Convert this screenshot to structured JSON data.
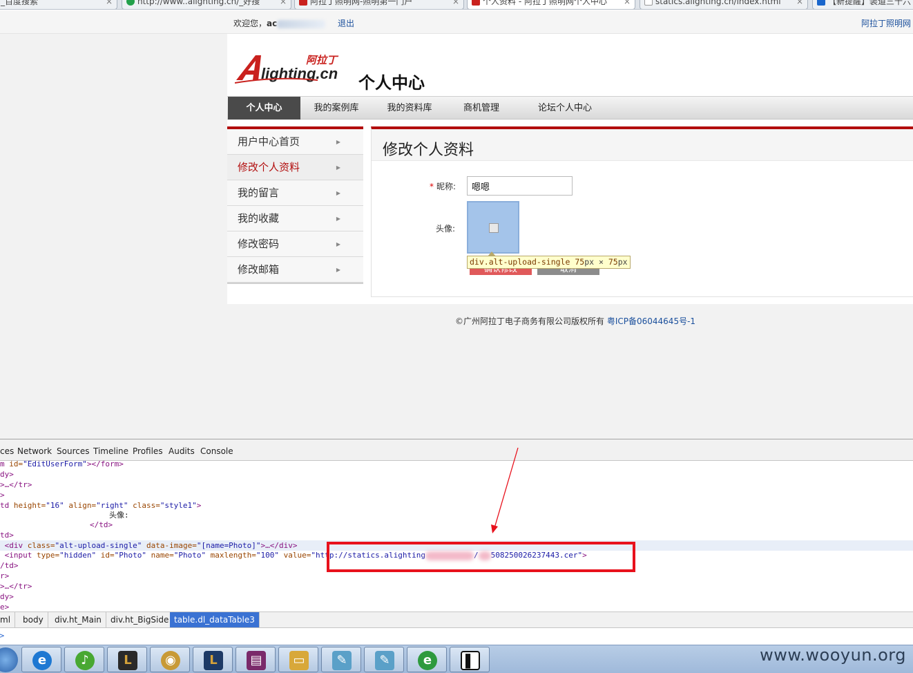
{
  "browser": {
    "tabs": [
      {
        "label": "_百度搜索",
        "favicon_color": "#3f7ee0",
        "active": false
      },
      {
        "label": "http://www..alighting.cn/_好搜",
        "favicon_color": "#23a04a",
        "active": false
      },
      {
        "label": "阿拉丁照明网-照明第一门户",
        "favicon_color": "#c9211e",
        "active": false
      },
      {
        "label": "个人资料 - 阿拉丁照明网个人中心",
        "favicon_color": "#c9211e",
        "active": true
      },
      {
        "label": "statics.alighting.cn/index.html",
        "favicon_color": "#ffffff",
        "active": false
      },
      {
        "label": "【新提醒】装道三十六",
        "favicon_color": "#1a66cc",
        "active": false
      }
    ],
    "close_glyph": "×"
  },
  "topbar": {
    "welcome_label": "欢迎您，",
    "username_visible": "ac",
    "logout": "退出",
    "site_link": "阿拉丁照明网"
  },
  "header": {
    "logo_text": "Alighting.cn",
    "logo_cn": "阿拉丁",
    "page_title": "个人中心"
  },
  "mainnav": {
    "items": [
      "个人中心",
      "我的案例库",
      "我的资料库",
      "商机管理",
      "论坛个人中心"
    ]
  },
  "sidemenu": {
    "items": [
      "用户中心首页",
      "修改个人资料",
      "我的留言",
      "我的收藏",
      "修改密码",
      "修改邮箱"
    ],
    "arrow": "▶"
  },
  "form": {
    "title": "修改个人资料",
    "required_mark": "*",
    "nickname_label": "昵称:",
    "nickname_value": "嗯嗯",
    "avatar_label": "头像:",
    "save_button": "确认修改",
    "cancel_button": "取消",
    "tooltip_selector": "div.alt-upload-single",
    "tooltip_w": "75",
    "tooltip_h": "75",
    "tooltip_unit": "px",
    "tooltip_times": "×"
  },
  "footer": {
    "copyright": "©广州阿拉丁电子商务有限公司版权所有",
    "icp": "粤ICP备06044645号-1"
  },
  "devtools": {
    "tabs": [
      "ces",
      "Network",
      "Sources",
      "Timeline",
      "Profiles",
      "Audits",
      "Console"
    ],
    "lines": [
      {
        "pre": "m ",
        "attr": "id=",
        "val": "\"EditUserForm\"",
        "post": "></form>"
      },
      {
        "pre": "dy>",
        "attr": "",
        "val": "",
        "post": ""
      },
      {
        "pre": ">…</tr>",
        "attr": "",
        "val": "",
        "post": ""
      },
      {
        "pre": ">",
        "attr": "",
        "val": "",
        "post": ""
      },
      {
        "pre": "td ",
        "attr": "height=",
        "val": "\"16\"",
        "post": ""
      },
      {
        "pre": "",
        "attr": "",
        "val": "",
        "post": ""
      },
      {
        "pre": "",
        "attr": "",
        "val": "",
        "post": ""
      },
      {
        "pre": "td>",
        "attr": "",
        "val": "",
        "post": ""
      }
    ],
    "td_line_rest": " align=\"right\" class=\"style1\">",
    "avatar_text": "头像:",
    "close_td": "</td>",
    "div_line": {
      "tag": "<div ",
      "attr1": "class=",
      "val1": "\"alt-upload-single\"",
      "attr2": " data-image=",
      "val2": "\"[name=Photo]\"",
      "post": ">…</div>"
    },
    "input_line": {
      "tag": "<input ",
      "a1": "type=",
      "v1": "\"hidden\"",
      "a2": " id=",
      "v2": "\"Photo\"",
      "a3": " name=",
      "v3": "\"Photo\"",
      "a4": " maxlength=",
      "v4": "\"100\"",
      "a5": " value=",
      "v5_start": "\"http://statics.alighting",
      "v5_mid": "/",
      "v5_end": "508250026237443.cer\"",
      "post": ">"
    },
    "tail_lines": [
      "/td>",
      "r>",
      ">…</tr>",
      "dy>",
      "e>"
    ],
    "breadcrumbs": [
      "ml",
      "body",
      "div.ht_Main",
      "div.ht_BigSide",
      "table.dl_dataTable3"
    ],
    "console_prompt": ">"
  },
  "taskbar": {
    "buttons": [
      {
        "name": "ie-icon",
        "glyph": "e",
        "color": "#1e78d2"
      },
      {
        "name": "music-player-icon",
        "glyph": "♪",
        "color": "#48a832"
      },
      {
        "name": "league-icon",
        "glyph": "L",
        "color": "#2a2a2a"
      },
      {
        "name": "webcam-icon",
        "glyph": "◉",
        "color": "#c89a36"
      },
      {
        "name": "league-client-icon",
        "glyph": "L",
        "color": "#1d3a66"
      },
      {
        "name": "winrar-icon",
        "glyph": "▤",
        "color": "#7a2a6a"
      },
      {
        "name": "folder-icon",
        "glyph": "▭",
        "color": "#d8a83a"
      },
      {
        "name": "notepad-icon",
        "glyph": "✎",
        "color": "#5aa0c8"
      },
      {
        "name": "notepad2-icon",
        "glyph": "✎",
        "color": "#5aa0c8"
      },
      {
        "name": "browser-e-icon",
        "glyph": "e",
        "color": "#2e9a3e"
      },
      {
        "name": "terminal-icon",
        "glyph": "▌",
        "color": "#111111"
      }
    ]
  },
  "watermark": "www.wooyun.org",
  "colors": {
    "accent_red": "#b20d0d",
    "link_blue": "#1a4f9c",
    "highlight_box": "#e8111c"
  }
}
